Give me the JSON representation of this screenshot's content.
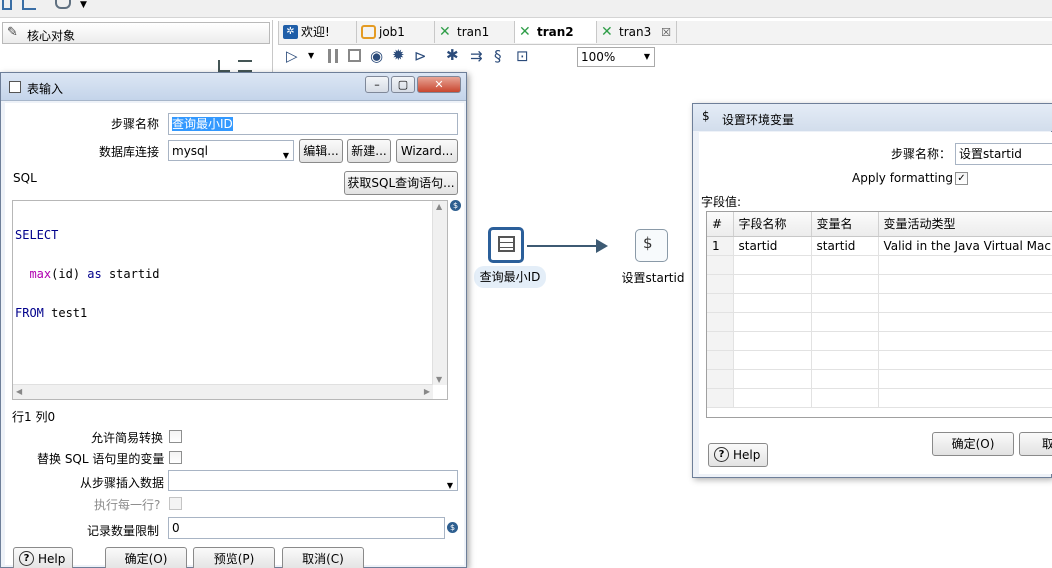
{
  "editor_tabs": [
    {
      "label": "欢迎!",
      "icon": "welcome-icon"
    },
    {
      "label": "job1",
      "icon": "job-icon"
    },
    {
      "label": "tran1",
      "icon": "transformation-icon"
    },
    {
      "label": "tran2",
      "icon": "transformation-icon",
      "active": true
    },
    {
      "label": "tran3",
      "icon": "transformation-icon",
      "close": "☒"
    }
  ],
  "left_panel": {
    "tab_label": "核心对象"
  },
  "toolbar": {
    "zoom": "100%"
  },
  "canvas": {
    "nodes": [
      {
        "label": "查询最小ID",
        "icon": "table-input-icon"
      },
      {
        "label": "设置startid",
        "icon": "set-variables-icon"
      }
    ]
  },
  "table_input_dialog": {
    "title": "表输入",
    "step_name_label": "步骤名称",
    "step_name_value": "查询最小ID",
    "db_conn_label": "数据库连接",
    "db_conn_value": "mysql",
    "edit_button": "编辑...",
    "new_button": "新建...",
    "wizard_button": "Wizard...",
    "sql_label": "SQL",
    "get_sql_button": "获取SQL查询语句...",
    "sql_lines": [
      [
        {
          "text": "SELECT",
          "cls": "kw"
        }
      ],
      [
        {
          "text": "  ",
          "cls": ""
        },
        {
          "text": "max",
          "cls": "fn"
        },
        {
          "text": "(id) ",
          "cls": ""
        },
        {
          "text": "as",
          "cls": "kw"
        },
        {
          "text": " startid",
          "cls": ""
        }
      ],
      [
        {
          "text": "FROM",
          "cls": "kw"
        },
        {
          "text": " test1",
          "cls": ""
        }
      ]
    ],
    "cursor_pos": "行1 列0",
    "lazy_conversion_label": "允许简易转换",
    "replace_vars_label": "替换 SQL 语句里的变量",
    "insert_from_step_label": "从步骤插入数据",
    "insert_from_step_value": "",
    "execute_each_row_label": "执行每一行?",
    "limit_label": "记录数量限制",
    "limit_value": "0",
    "help_button": "Help",
    "ok_button": "确定(O)",
    "preview_button": "预览(P)",
    "cancel_button": "取消(C)"
  },
  "set_vars_dialog": {
    "title": "设置环境变量",
    "step_name_label": "步骤名称：",
    "step_name_value": "设置startid",
    "apply_formatting_label": "Apply formatting",
    "apply_formatting_checked": true,
    "fields_label": "字段值:",
    "columns": [
      "#",
      "字段名称",
      "变量名",
      "变量活动类型"
    ],
    "rows": [
      [
        "1",
        "startid",
        "startid",
        "Valid in the Java Virtual Machine"
      ]
    ],
    "help_button": "Help",
    "ok_button": "确定(O)",
    "cancel_button": "取"
  }
}
